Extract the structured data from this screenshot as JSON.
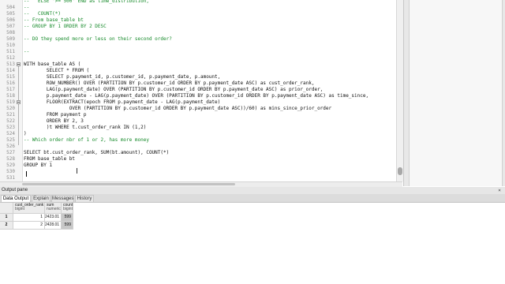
{
  "editor": {
    "top_lines": [
      {
        "n": "",
        "text": "--   ELSE '>= 500' END as time_distribution,",
        "comment": true
      },
      {
        "n": "504",
        "text": "--",
        "comment": true
      },
      {
        "n": "505",
        "text": "--   COUNT(*)",
        "comment": true
      },
      {
        "n": "506",
        "text": "-- From base_table bt",
        "comment": true
      },
      {
        "n": "507",
        "text": "-- GROUP BY 1 ORDER BY 2 DESC",
        "comment": true
      },
      {
        "n": "508",
        "text": "",
        "comment": false
      },
      {
        "n": "509",
        "text": "-- DO they spend more or less on their second order?",
        "comment": true
      },
      {
        "n": "510",
        "text": "",
        "comment": false
      },
      {
        "n": "511",
        "text": "--",
        "comment": true
      },
      {
        "n": "512",
        "text": "",
        "comment": false
      },
      {
        "n": "513",
        "text": "WITH base_table AS (",
        "comment": false
      },
      {
        "n": "514",
        "text": "        SELECT * FROM (",
        "comment": false
      },
      {
        "n": "515",
        "text": "        SELECT p.payment_id, p.customer_id, p.payment_date, p.amount,",
        "comment": false
      },
      {
        "n": "516",
        "text": "        ROW_NUMBER() OVER (PARTITION BY p.customer_id ORDER BY p.payment_date ASC) as cust_order_rank,",
        "comment": false
      },
      {
        "n": "517",
        "text": "        LAG(p.payment_date) OVER (PARTITION BY p.customer_id ORDER BY p.payment_date ASC) as prior_order,",
        "comment": false
      },
      {
        "n": "518",
        "text": "        p.payment_date - LAG(p.payment_date) OVER (PARTITION BY p.customer_id ORDER BY p.payment_date ASC) as time_since,",
        "comment": false
      },
      {
        "n": "519",
        "text": "        FLOOR(EXTRACT(epoch FROM p.payment_date - LAG(p.payment_date)",
        "comment": false
      },
      {
        "n": "520",
        "text": "                OVER (PARTITION BY p.customer_id ORDER BY p.payment_date ASC))/60) as mins_since_prior_order",
        "comment": false
      },
      {
        "n": "521",
        "text": "        FROM payment p",
        "comment": false
      },
      {
        "n": "522",
        "text": "        ORDER BY 2, 3",
        "comment": false
      },
      {
        "n": "523",
        "text": "        )t WHERE t.cust_order_rank IN (1,2)",
        "comment": false
      },
      {
        "n": "524",
        "text": ")",
        "comment": false
      },
      {
        "n": "525",
        "text": "-- Which order nbr of 1 or 2, has more money",
        "comment": true
      },
      {
        "n": "526",
        "text": "",
        "comment": false
      },
      {
        "n": "527",
        "text": "SELECT bt.cust_order_rank, SUM(bt.amount), COUNT(*)",
        "comment": false
      },
      {
        "n": "528",
        "text": "FROM base_table bt",
        "comment": false
      },
      {
        "n": "529",
        "text": "GROUP BY 1",
        "comment": false
      },
      {
        "n": "530",
        "text": "",
        "comment": false
      },
      {
        "n": "531",
        "text": "",
        "comment": false
      }
    ]
  },
  "output_pane": {
    "title": "Output pane",
    "close_glyph": "×",
    "tabs": [
      "Data Output",
      "Explain",
      "Messages",
      "History"
    ],
    "active_tab": 0,
    "columns": [
      {
        "name": "cust_order_rank",
        "type": "bigint"
      },
      {
        "name": "sum",
        "type": "numeric"
      },
      {
        "name": "count",
        "type": "bigint"
      }
    ],
    "rows": [
      {
        "num": "1",
        "cells": [
          "1",
          "2423.01",
          "599"
        ]
      },
      {
        "num": "2",
        "cells": [
          "2",
          "2428.01",
          "599"
        ]
      }
    ]
  },
  "colors": {
    "comment": "#168a2a",
    "selected_cell": "#c8c8c8"
  }
}
